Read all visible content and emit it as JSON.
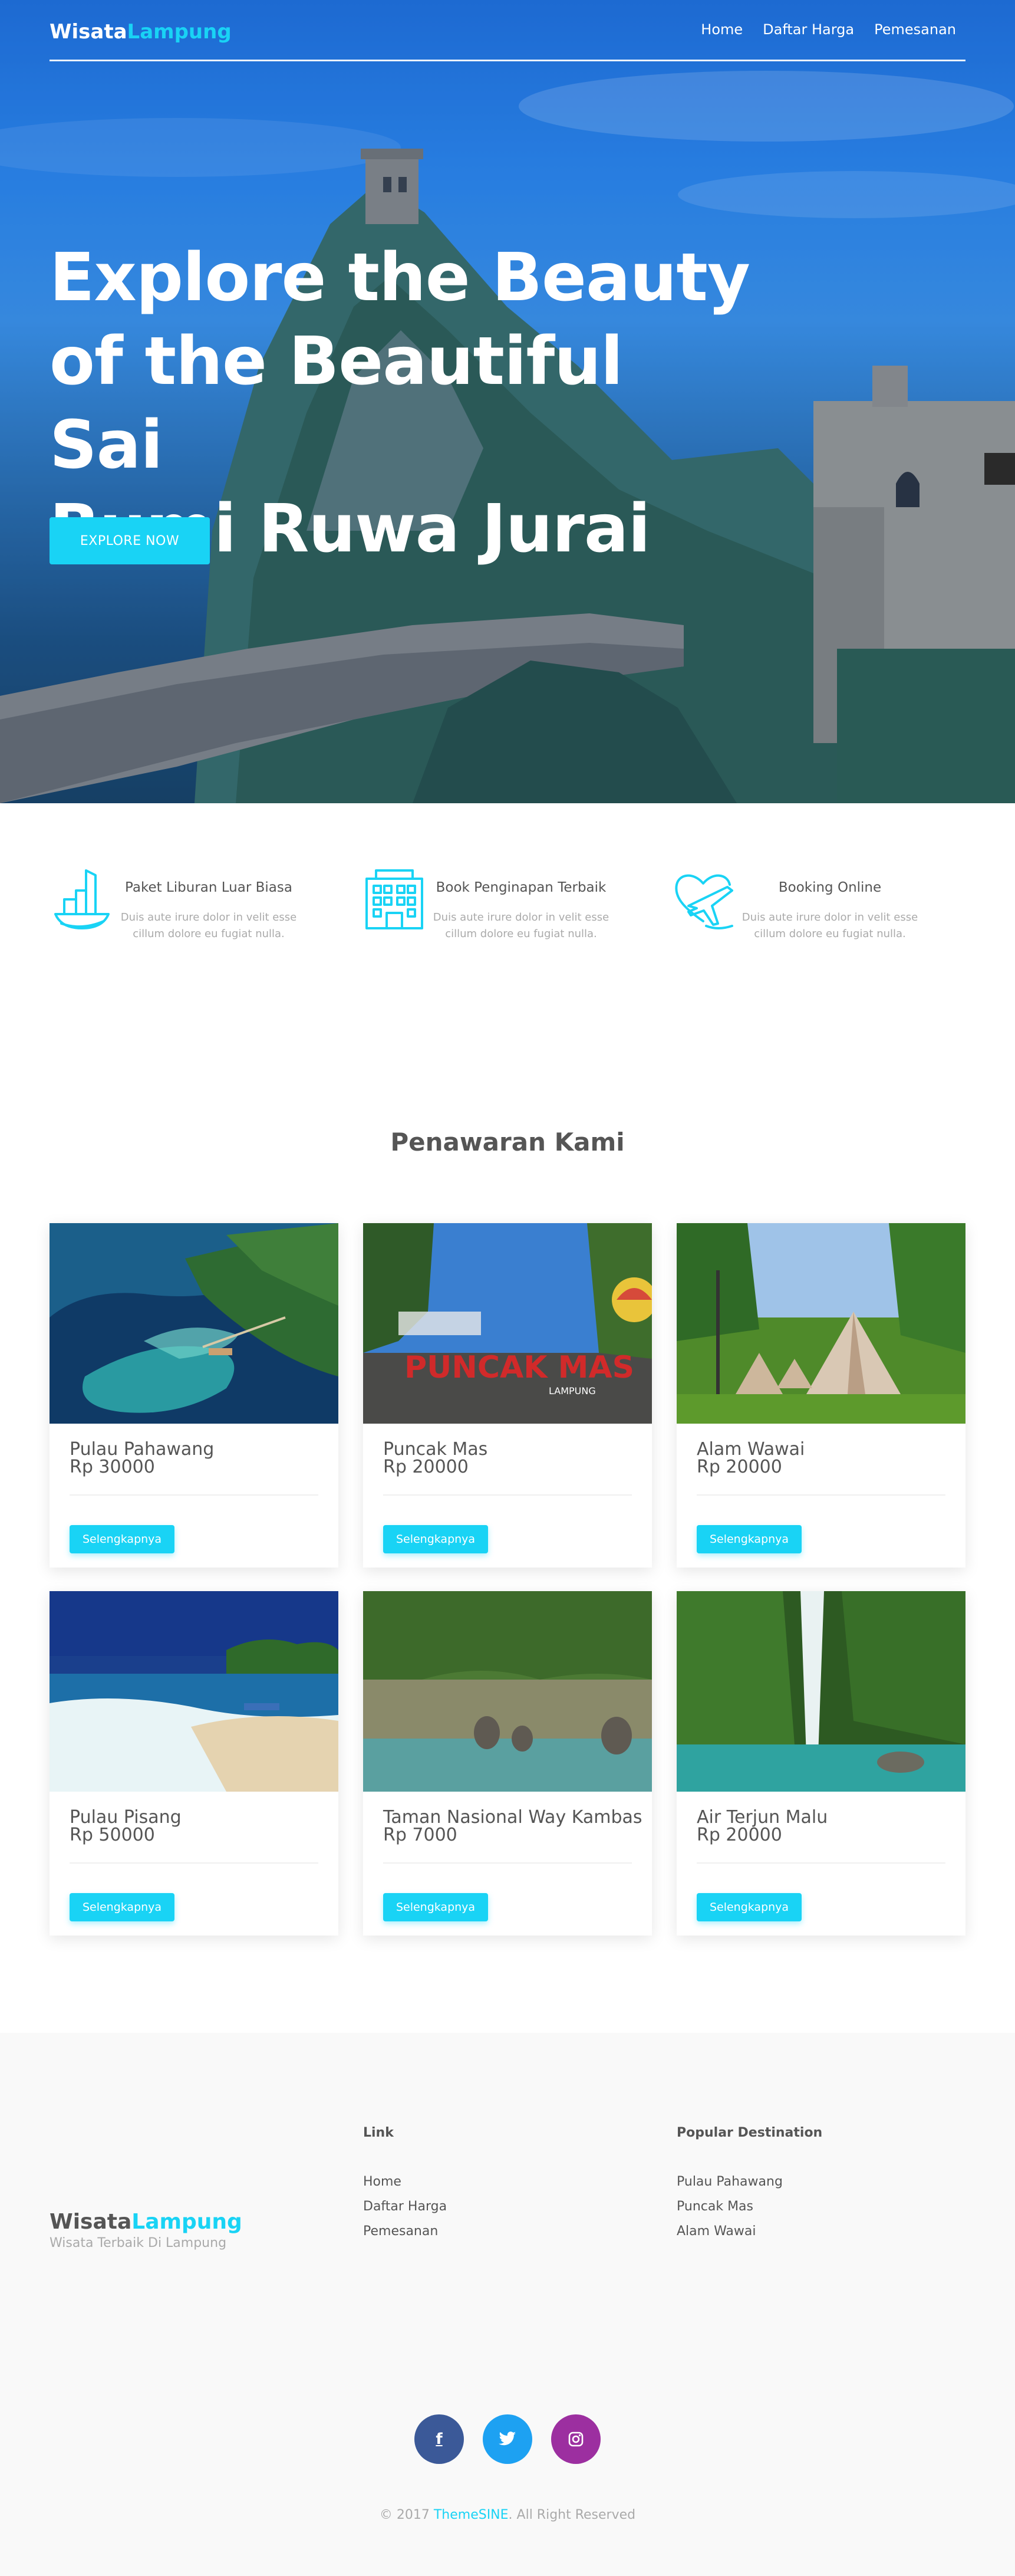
{
  "brand": {
    "name_part1": "Wisata",
    "name_part2": "Lampung",
    "accent": "#19d3f5"
  },
  "nav": {
    "items": [
      "Home",
      "Daftar Harga",
      "Pemesanan"
    ]
  },
  "hero": {
    "title_lines": [
      "Explore the Beauty",
      "of the Beautiful Sai",
      "Bumi Ruwa Jurai"
    ],
    "button_label": "EXPLORE NOW"
  },
  "features": [
    {
      "icon": "boat-icon",
      "title": "Paket Liburan Luar Biasa",
      "desc": "Duis aute irure dolor in velit esse cillum dolore eu fugiat nulla."
    },
    {
      "icon": "hotel-icon",
      "title": "Book Penginapan Terbaik",
      "desc": "Duis aute irure dolor in velit esse cillum dolore eu fugiat nulla."
    },
    {
      "icon": "plane-heart-icon",
      "title": "Booking Online",
      "desc": "Duis aute irure dolor in velit esse cillum dolore eu fugiat nulla."
    }
  ],
  "offers": {
    "title": "Penawaran Kami",
    "button_label": "Selengkapnya",
    "items": [
      {
        "name": "Pulau Pahawang",
        "price": "Rp 30000"
      },
      {
        "name": "Puncak Mas",
        "price": "Rp 20000"
      },
      {
        "name": "Alam Wawai",
        "price": "Rp 20000"
      },
      {
        "name": "Pulau Pisang",
        "price": "Rp 50000"
      },
      {
        "name": "Taman Nasional Way Kambas",
        "price": "Rp 7000"
      },
      {
        "name": "Air Terjun Malu",
        "price": "Rp 20000"
      }
    ],
    "puncak_sign": "PUNCAK MAS",
    "puncak_sign_sub": "LAMPUNG"
  },
  "footer": {
    "tagline": "Wisata Terbaik Di Lampung",
    "link_title": "Link",
    "links": [
      "Home",
      "Daftar Harga",
      "Pemesanan"
    ],
    "popular_title": "Popular Destination",
    "popular": [
      "Pulau Pahawang",
      "Puncak Mas",
      "Alam Wawai"
    ],
    "socials": [
      {
        "icon": "facebook-icon",
        "glyph": "f",
        "color": "#3b5998"
      },
      {
        "icon": "twitter-icon",
        "glyph": "❧",
        "color": "#1da1f2"
      },
      {
        "icon": "instagram-icon",
        "glyph": "◎",
        "color": "#9c2fa0"
      }
    ],
    "copyright_prefix": "© 2017 ",
    "copyright_brand": "ThemeSINE",
    "copyright_suffix": ". All Right Reserved"
  }
}
